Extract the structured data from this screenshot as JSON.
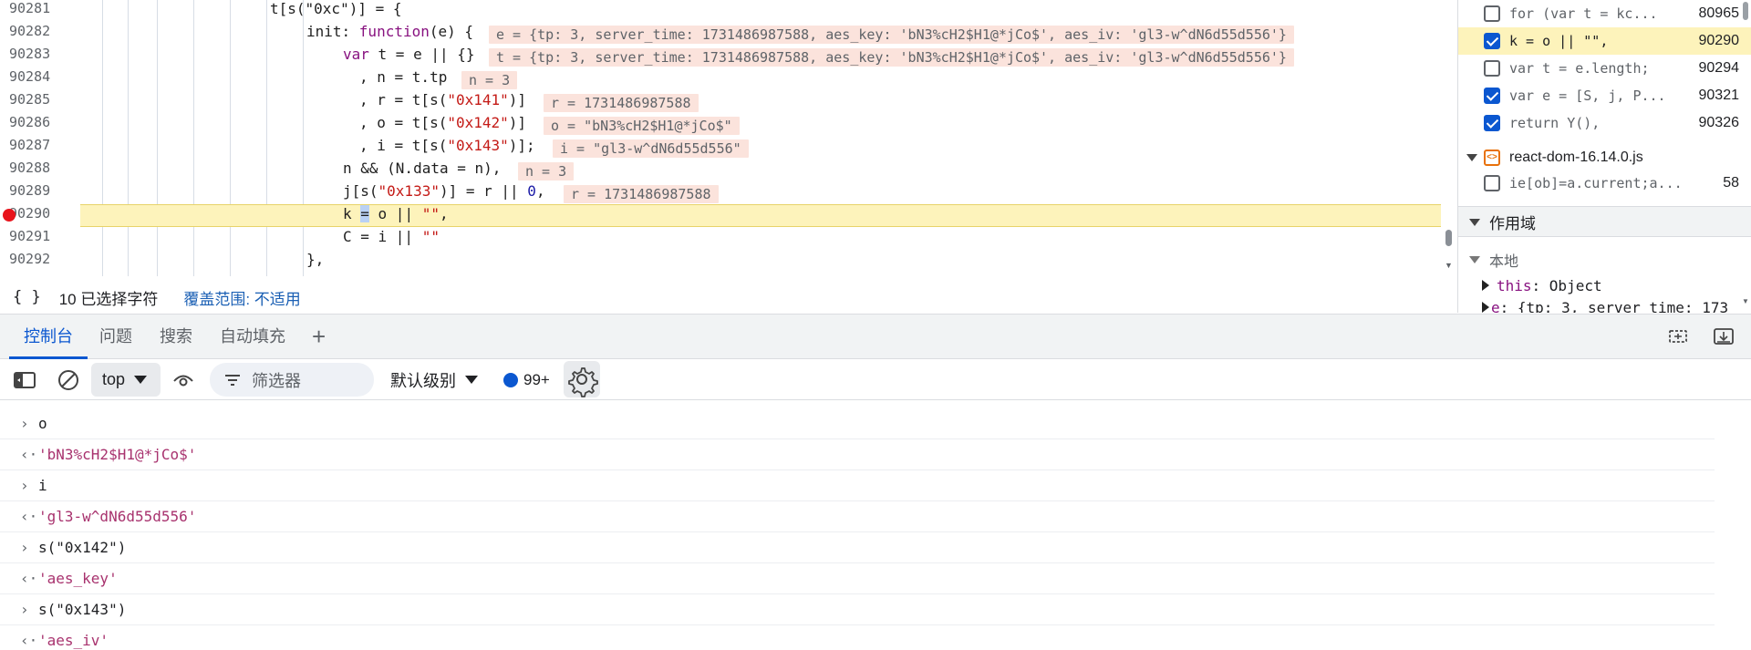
{
  "editor": {
    "lines": [
      {
        "num": "90281"
      },
      {
        "num": "90282"
      },
      {
        "num": "90283"
      },
      {
        "num": "90284"
      },
      {
        "num": "90285"
      },
      {
        "num": "90286"
      },
      {
        "num": "90287"
      },
      {
        "num": "90288"
      },
      {
        "num": "90289"
      },
      {
        "num": "90290"
      },
      {
        "num": "90291"
      },
      {
        "num": "90292"
      }
    ],
    "code": {
      "l90281": "t[s(\"0xc\")] = {",
      "l90282_key": "init",
      "l90282_kw": "function",
      "l90282_rest": "(e) {",
      "l90283_kw": "var",
      "l90283_rest": " t = e || {}",
      "l90284": ", n = t.tp",
      "l90285_a": ", r = t[s(",
      "l90285_s": "\"0x141\"",
      "l90285_b": ")]",
      "l90286_a": ", o = t[s(",
      "l90286_s": "\"0x142\"",
      "l90286_b": ")]",
      "l90287_a": ", i = t[s(",
      "l90287_s": "\"0x143\"",
      "l90287_b": ")];",
      "l90288": "n && (N.data = n),",
      "l90289_a": "j[s(",
      "l90289_s": "\"0x133\"",
      "l90289_b": ")] = r || ",
      "l90289_n": "0",
      "l90289_c": ",",
      "l90290_a": "k ",
      "l90290_sel": "=",
      "l90290_b": " o || ",
      "l90290_s": "\"\"",
      "l90290_c": ",",
      "l90291_a": "C = i || ",
      "l90291_s": "\"\"",
      "l90292": "},"
    },
    "inline_values": {
      "l90282": "e = {tp: 3, server_time: 1731486987588, aes_key: 'bN3%cH2$H1@*jCo$', aes_iv: 'gl3-w^dN6d55d556'}",
      "l90283": "t = {tp: 3, server_time: 1731486987588, aes_key: 'bN3%cH2$H1@*jCo$', aes_iv: 'gl3-w^dN6d55d556'}",
      "l90284": "n = 3",
      "l90285": "r = 1731486987588",
      "l90286": "o = \"bN3%cH2$H1@*jCo$\"",
      "l90287": "i = \"gl3-w^dN6d55d556\"",
      "l90288": "n = 3",
      "l90289": "r = 1731486987588"
    },
    "status": {
      "braces": "{ }",
      "selection": "10 已选择字符",
      "coverage": "覆盖范围: 不适用"
    }
  },
  "sidebar": {
    "breakpoints": [
      {
        "code": "for (var t = kc...",
        "line": "80965",
        "checked": false
      },
      {
        "code": "k = o || \"\",",
        "line": "90290",
        "checked": true
      },
      {
        "code": "var t = e.length;",
        "line": "90294",
        "checked": false
      },
      {
        "code": "var e = [S, j, P...",
        "line": "90321",
        "checked": true
      },
      {
        "code": "return Y(),",
        "line": "90326",
        "checked": true
      }
    ],
    "file": {
      "name": "react-dom-16.14.0.js"
    },
    "file_bp": {
      "code": "ie[ob]=a.current;a...",
      "line": "58"
    },
    "scope_header": "作用域",
    "local_label": "本地",
    "scope_this_key": "this",
    "scope_this_val": "Object",
    "scope_e_key": "e",
    "scope_e_val": "{tp: 3, server_time: 173"
  },
  "drawer": {
    "tabs": [
      "控制台",
      "问题",
      "搜索",
      "自动填充"
    ],
    "add": "+"
  },
  "toolbar": {
    "context": "top",
    "filter_placeholder": "筛选器",
    "level": "默认级别",
    "issues_count": "99+"
  },
  "console": {
    "entries": [
      {
        "type": "input",
        "text": "o"
      },
      {
        "type": "result",
        "text": "'bN3%cH2$H1@*jCo$'"
      },
      {
        "type": "input",
        "text": "i"
      },
      {
        "type": "result",
        "text": "'gl3-w^dN6d55d556'"
      },
      {
        "type": "input",
        "text": "s(\"0x142\")"
      },
      {
        "type": "result",
        "text": "'aes_key'"
      },
      {
        "type": "input",
        "text": "s(\"0x143\")"
      },
      {
        "type": "result",
        "text": "'aes_iv'"
      }
    ]
  },
  "colors": {
    "accent": "#0b57d0",
    "current_line": "#fdf3bb",
    "inline_value_bg": "#fbe3dc",
    "breakpoint": "#e8141c",
    "console_result": "#a8326e"
  }
}
